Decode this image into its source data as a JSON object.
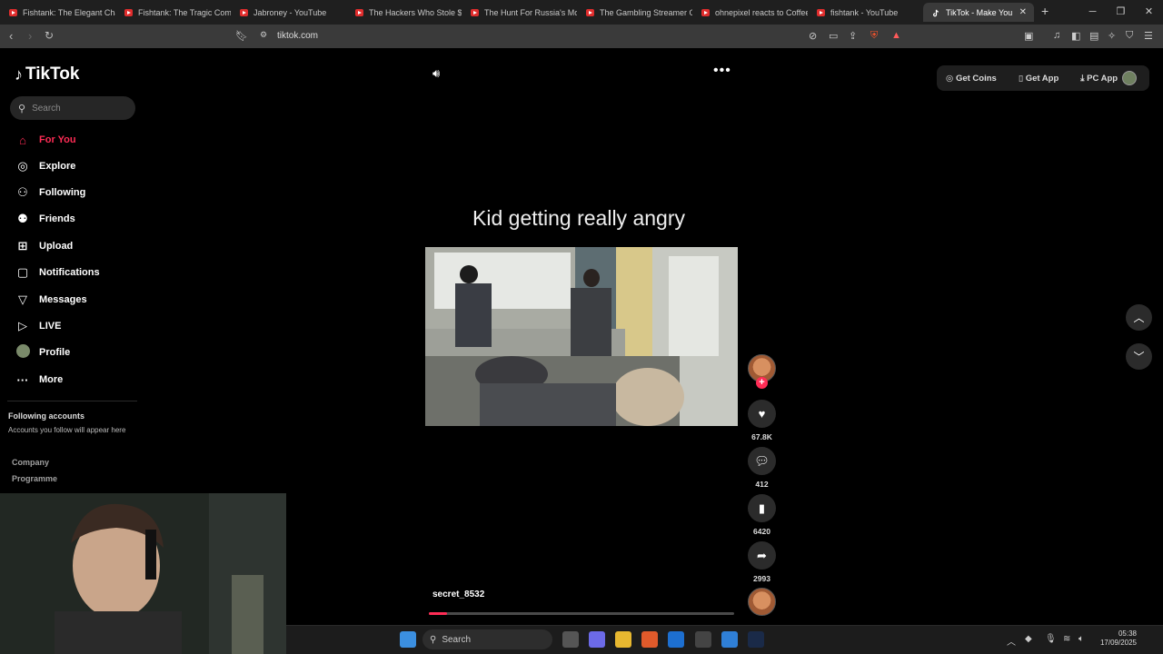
{
  "browser": {
    "tabs": [
      {
        "title": "Fishtank: The Elegant Cha"
      },
      {
        "title": "Fishtank: The Tragic Come"
      },
      {
        "title": "Jabroney - YouTube"
      },
      {
        "title": "The Hackers Who Stole $1"
      },
      {
        "title": "The Hunt For Russia's Mo"
      },
      {
        "title": "The Gambling Streamer G"
      },
      {
        "title": "ohnepixel reacts to Coffee"
      },
      {
        "title": "fishtank - YouTube"
      },
      {
        "title": "TikTok - Make You"
      }
    ],
    "url": "tiktok.com"
  },
  "sidebar": {
    "logo": "TikTok",
    "search_placeholder": "Search",
    "nav": [
      {
        "label": "For You",
        "icon": "home-icon"
      },
      {
        "label": "Explore",
        "icon": "compass-icon"
      },
      {
        "label": "Following",
        "icon": "following-icon"
      },
      {
        "label": "Friends",
        "icon": "friends-icon"
      },
      {
        "label": "Upload",
        "icon": "upload-icon"
      },
      {
        "label": "Notifications",
        "icon": "notifications-icon"
      },
      {
        "label": "Messages",
        "icon": "messages-icon"
      },
      {
        "label": "LIVE",
        "icon": "live-icon"
      },
      {
        "label": "Profile",
        "icon": "profile-icon"
      },
      {
        "label": "More",
        "icon": "more-icon"
      }
    ],
    "following_heading": "Following accounts",
    "following_sub": "Accounts you follow will appear here",
    "footer_links": [
      "Company",
      "Programme"
    ]
  },
  "header": {
    "get_coins": "Get Coins",
    "get_app": "Get App",
    "pc_app": "PC App"
  },
  "video": {
    "caption": "Kid getting really angry",
    "username": "secret_8532",
    "progress": 0.06
  },
  "actions": {
    "likes": "67.8K",
    "comments": "412",
    "saves": "6420",
    "shares": "2993"
  },
  "taskbar": {
    "search_placeholder": "Search",
    "time": "05:38",
    "date": "17/09/2025"
  }
}
